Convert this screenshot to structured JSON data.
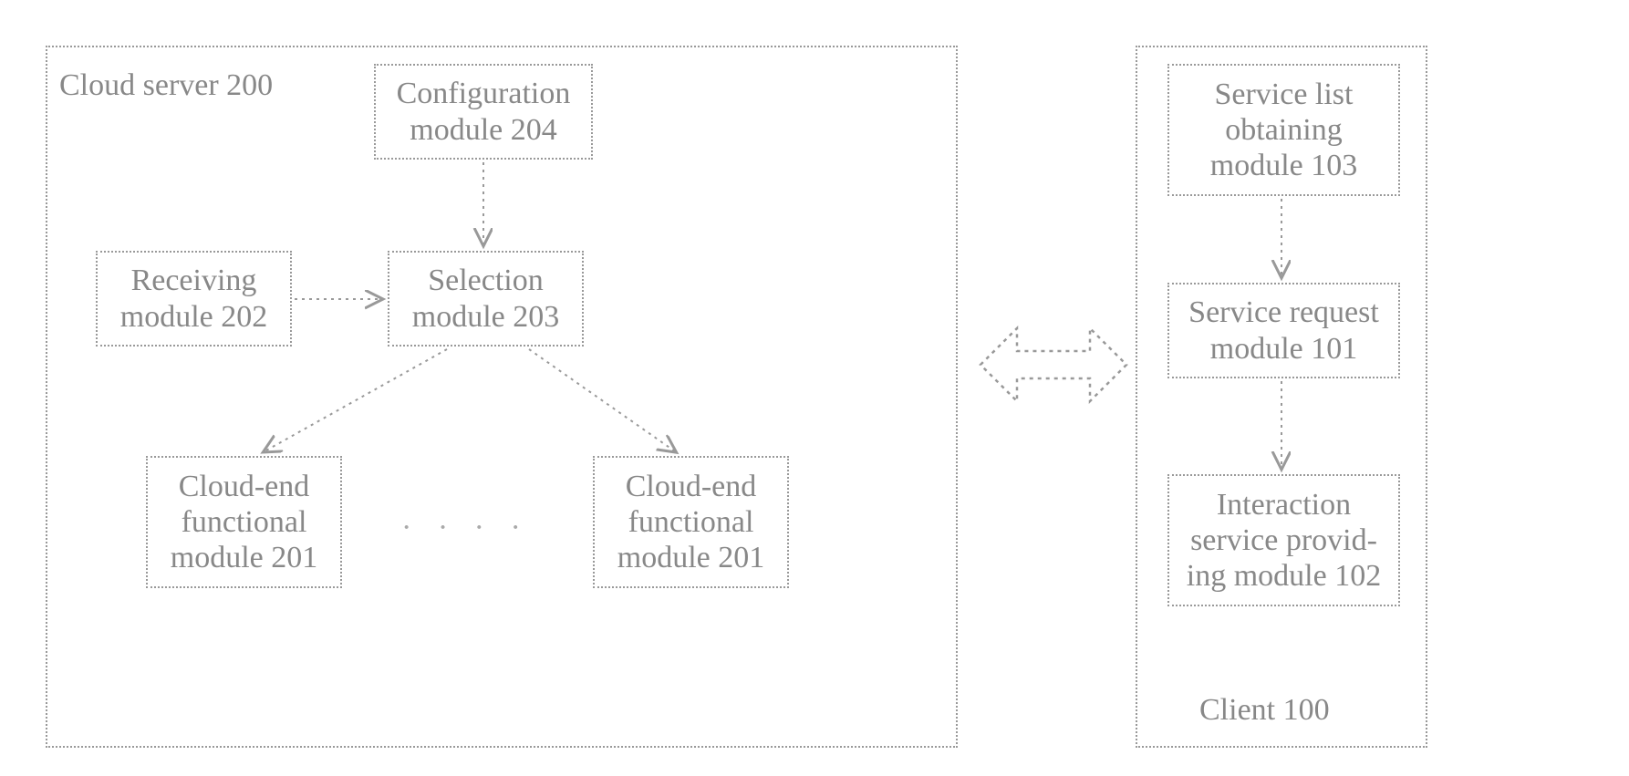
{
  "cloud_server": {
    "title": "Cloud server 200",
    "config": "Configuration\nmodule 204",
    "receiving": "Receiving\nmodule 202",
    "selection": "Selection\nmodule 203",
    "func_a": "Cloud-end\nfunctional\nmodule 201",
    "func_b": "Cloud-end\nfunctional\nmodule 201",
    "ellipsis": "· · · ·"
  },
  "client": {
    "title": "Client 100",
    "service_list": "Service list\nobtaining\nmodule 103",
    "service_request": "Service request\nmodule 101",
    "interaction": "Interaction\nservice provid-\ning module 102"
  }
}
